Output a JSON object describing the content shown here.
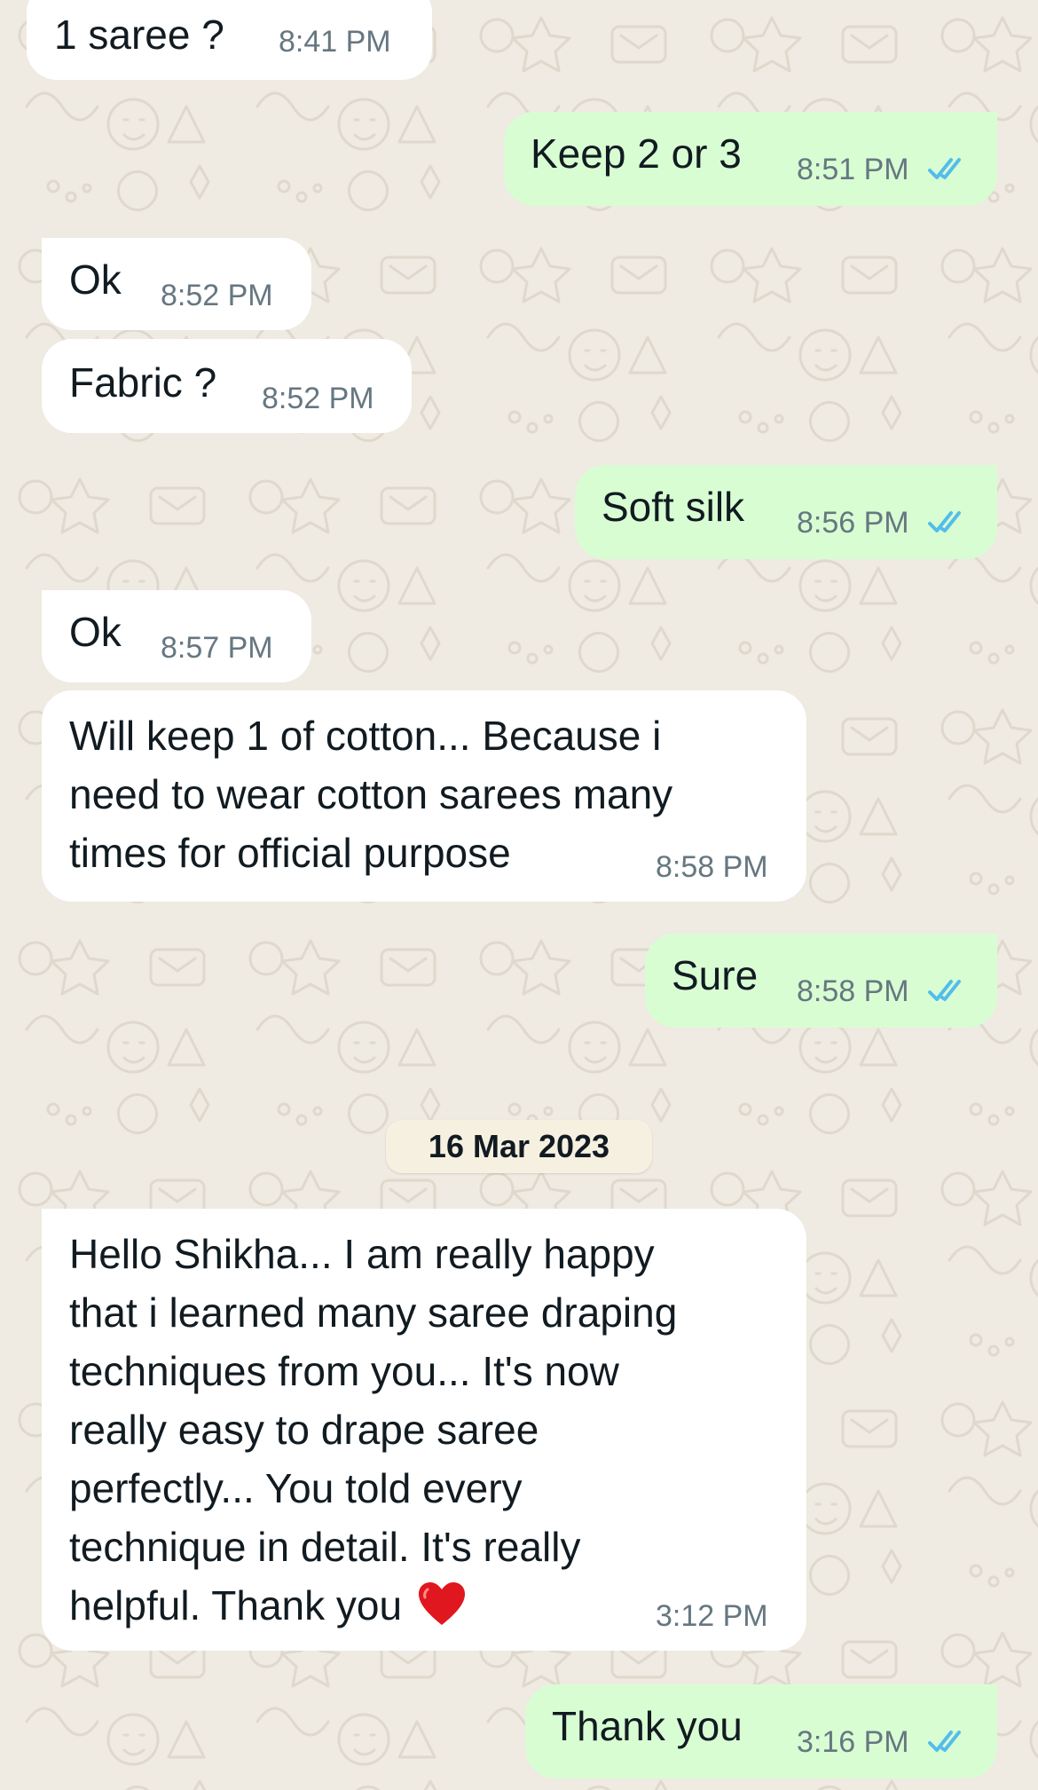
{
  "messages": [
    {
      "id": "m1",
      "dir": "incoming",
      "text": "1 saree ?",
      "time": "8:41 PM"
    },
    {
      "id": "m2",
      "dir": "outgoing",
      "text": "Keep 2 or 3",
      "time": "8:51 PM",
      "status": "read"
    },
    {
      "id": "m3",
      "dir": "incoming",
      "text": "Ok",
      "time": "8:52 PM"
    },
    {
      "id": "m4",
      "dir": "incoming",
      "text": "Fabric ?",
      "time": "8:52 PM"
    },
    {
      "id": "m5",
      "dir": "outgoing",
      "text": "Soft silk",
      "time": "8:56 PM",
      "status": "read"
    },
    {
      "id": "m6",
      "dir": "incoming",
      "text": "Ok",
      "time": "8:57 PM"
    },
    {
      "id": "m7",
      "dir": "incoming",
      "lines": [
        "Will keep 1 of cotton... Because i",
        "need to wear cotton sarees many",
        "times for official purpose"
      ],
      "time": "8:58 PM"
    },
    {
      "id": "m8",
      "dir": "outgoing",
      "text": "Sure",
      "time": "8:58 PM",
      "status": "read"
    },
    {
      "id": "m9",
      "dir": "incoming",
      "lines": [
        "Hello Shikha... I am really happy",
        "that i learned many saree draping",
        "techniques from you... It's now",
        "really easy to drape saree",
        "perfectly... You told every",
        "technique in detail. It's really",
        "helpful. Thank you"
      ],
      "emoji": "❤️",
      "time": "3:12 PM"
    },
    {
      "id": "m10",
      "dir": "outgoing",
      "text": "Thank you",
      "time": "3:16 PM",
      "status": "read"
    }
  ],
  "date_separator": "16 Mar 2023",
  "icons": {
    "read_receipt": "double-check-icon",
    "heart": "red-heart-emoji"
  },
  "colors": {
    "wallpaper": "#efeae2",
    "incoming_bubble": "#ffffff",
    "outgoing_bubble": "#d9fdd3",
    "read_ticks": "#53bdeb",
    "timestamp": "#667781",
    "heart": "#e0171f"
  }
}
